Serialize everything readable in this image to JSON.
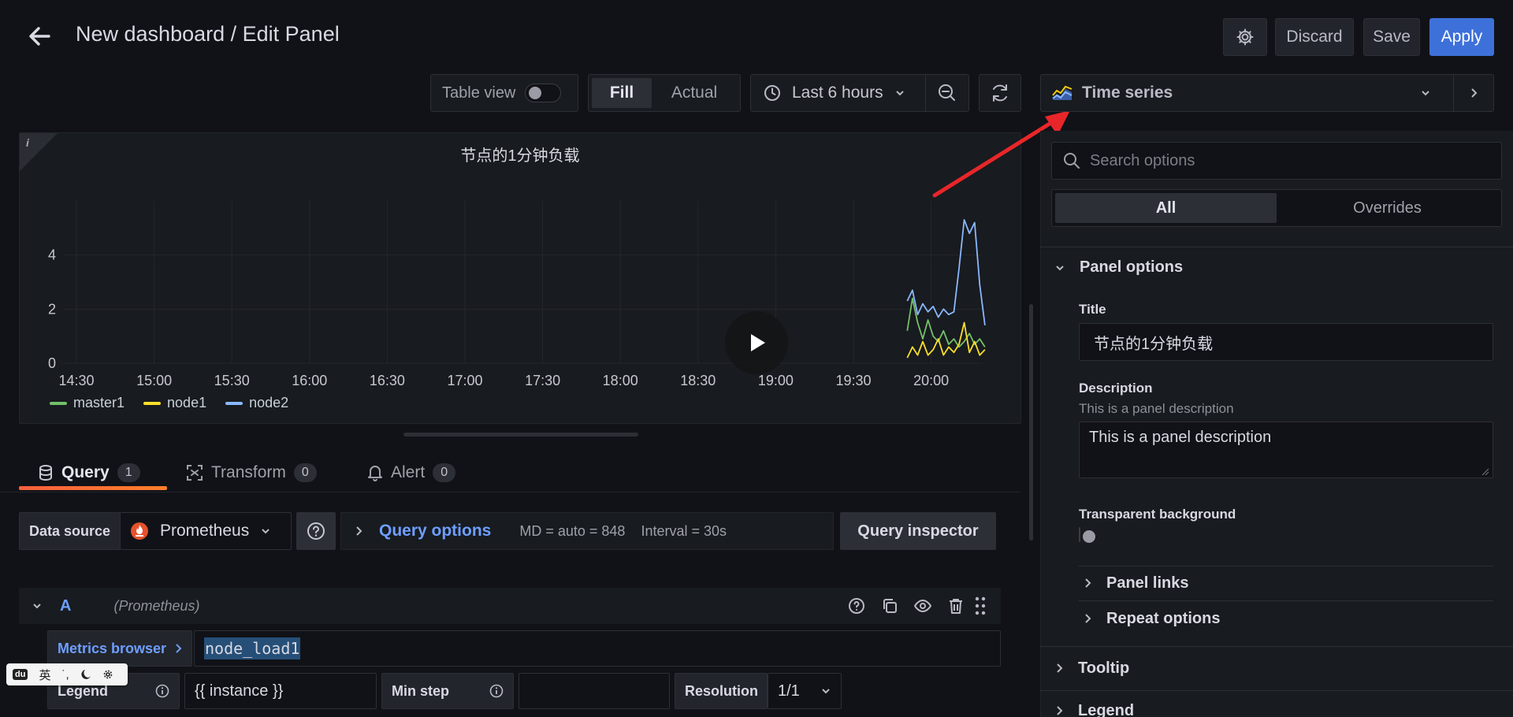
{
  "header": {
    "title": "New dashboard / Edit Panel",
    "discard_label": "Discard",
    "save_label": "Save",
    "apply_label": "Apply"
  },
  "toolbar": {
    "table_view_label": "Table view",
    "fill_label": "Fill",
    "actual_label": "Actual",
    "time_range_label": "Last 6 hours"
  },
  "panel": {
    "title": "节点的1分钟负载",
    "info_glyph": "i"
  },
  "chart_data": {
    "type": "line",
    "title": "节点的1分钟负载",
    "xlabel": "",
    "ylabel": "",
    "x_ticks": [
      "14:30",
      "15:00",
      "15:30",
      "16:00",
      "16:30",
      "17:00",
      "17:30",
      "18:00",
      "18:30",
      "19:00",
      "19:30",
      "20:00"
    ],
    "y_ticks": [
      0,
      2,
      4
    ],
    "ylim": [
      0,
      6
    ],
    "grid": true,
    "legend": "bottom-left",
    "x": [
      "19:52",
      "19:54",
      "19:56",
      "19:58",
      "20:00",
      "20:02",
      "20:04",
      "20:06",
      "20:08",
      "20:10",
      "20:12",
      "20:14",
      "20:16",
      "20:18",
      "20:20",
      "20:22"
    ],
    "series": [
      {
        "name": "master1",
        "color": "#73bf69",
        "values": [
          1.2,
          2.4,
          1.5,
          0.9,
          1.6,
          1.0,
          0.8,
          1.2,
          0.7,
          0.9,
          0.6,
          0.8,
          1.1,
          0.7,
          0.9,
          0.6
        ]
      },
      {
        "name": "node1",
        "color": "#fade2a",
        "values": [
          0.2,
          0.6,
          0.3,
          0.8,
          0.3,
          0.5,
          0.9,
          0.3,
          0.6,
          0.4,
          0.7,
          1.5,
          0.4,
          0.8,
          0.3,
          0.5
        ]
      },
      {
        "name": "node2",
        "color": "#8ab8ff",
        "values": [
          2.3,
          2.7,
          1.8,
          2.2,
          1.9,
          2.1,
          1.7,
          2.0,
          1.8,
          1.9,
          3.5,
          5.3,
          4.8,
          5.2,
          2.9,
          1.4
        ]
      }
    ]
  },
  "tabs": [
    {
      "label": "Query",
      "count": "1"
    },
    {
      "label": "Transform",
      "count": "0"
    },
    {
      "label": "Alert",
      "count": "0"
    }
  ],
  "query": {
    "datasource_label": "Data source",
    "datasource_value": "Prometheus",
    "query_options_label": "Query options",
    "md_text": "MD = auto = 848",
    "interval_text": "Interval = 30s",
    "inspector_label": "Query inspector",
    "row_letter": "A",
    "row_source": "(Prometheus)",
    "metrics_browser_label": "Metrics browser",
    "expression": "node_load1",
    "legend_label": "Legend",
    "legend_value": "{{ instance }}",
    "min_step_label": "Min step",
    "resolution_label": "Resolution",
    "resolution_value": "1/1"
  },
  "ime": {
    "logo": "du",
    "lang": "英",
    "punct": "˙,"
  },
  "options": {
    "viz_label": "Time series",
    "search_placeholder": "Search options",
    "all_label": "All",
    "overrides_label": "Overrides",
    "panel_options_label": "Panel options",
    "title_label": "Title",
    "title_value": "节点的1分钟负载",
    "description_label": "Description",
    "description_hint": "This is a panel description",
    "description_value": "This is a panel description",
    "transparent_label": "Transparent background",
    "panel_links_label": "Panel links",
    "repeat_options_label": "Repeat options",
    "tooltip_label": "Tooltip",
    "legend_label": "Legend"
  },
  "colors": {
    "accent": "#3d71d9",
    "link": "#6e9fff",
    "annotation_arrow": "#e8262a"
  }
}
